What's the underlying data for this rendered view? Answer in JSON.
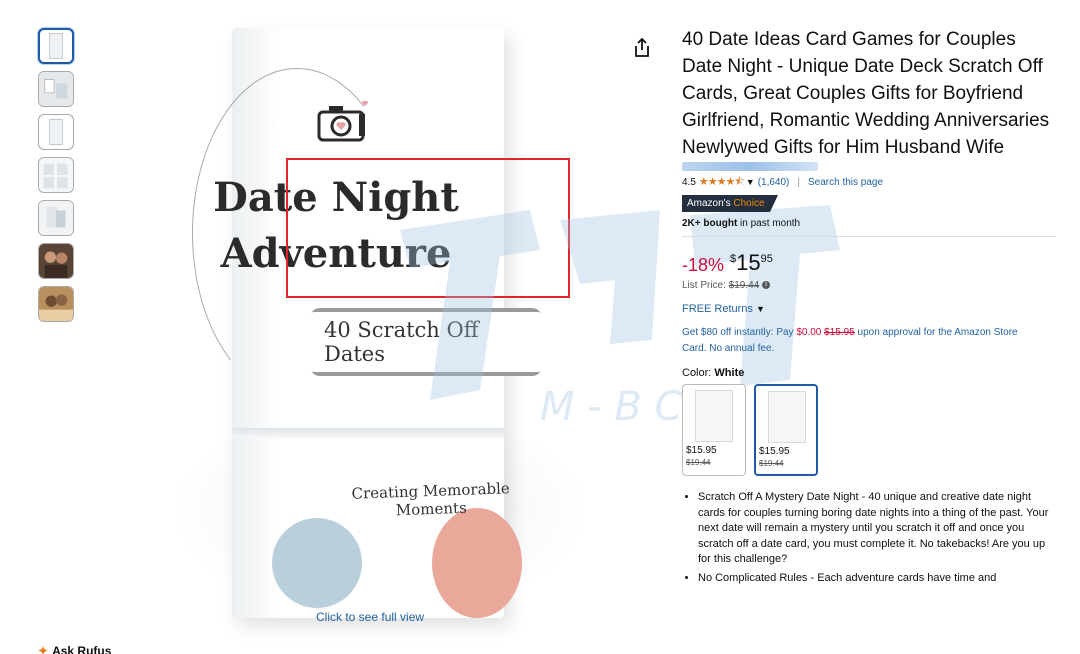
{
  "gallery": {
    "thumbnails": [
      "thumb-1",
      "thumb-2",
      "thumb-3",
      "thumb-4",
      "thumb-5",
      "thumb-6",
      "thumb-7"
    ],
    "click_full_view": "Click to see full view",
    "ask_rufus": "Ask Rufus"
  },
  "box": {
    "title_line1": "Date Night",
    "title_line2": "Adventure",
    "scratch_label": "40 Scratch Off Dates",
    "tagline": "Creating Memorable Moments"
  },
  "product": {
    "title": "40 Date Ideas Card Games for Couples Date Night - Unique Date Deck Scratch Off Cards, Great Couples Gifts for Boyfriend Girlfriend, Romantic Wedding Anniversaries Newlywed Gifts for Him Husband Wife",
    "rating_value": "4.5",
    "rating_stars": "★★★★⯪",
    "rating_count": "(1,640)",
    "search_page": "Search this page",
    "badge_prefix": "Amazon's",
    "badge_choice": "Choice",
    "bought_bold": "2K+ bought",
    "bought_rest": " in past month",
    "discount": "-18%",
    "price_symbol": "$",
    "price_whole": "15",
    "price_fraction": "95",
    "list_price_label": "List Price: ",
    "list_price_value": "$19.44",
    "free_returns": "FREE Returns",
    "promo_part1": "Get $80 off instantly: Pay ",
    "promo_zero": "$0.00",
    "promo_old": "$15.95",
    "promo_part2": " upon approval for the Amazon Store Card. No annual fee.",
    "color_label": "Color: ",
    "color_value": "White",
    "swatches": [
      {
        "price": "$15.95",
        "old": "$19.44"
      },
      {
        "price": "$15.95",
        "old": "$19.44"
      }
    ],
    "bullets": [
      "Scratch Off A Mystery Date Night - 40 unique and creative date night cards for couples turning boring date nights into a thing of the past. Your next date will remain a mystery until you scratch it off and once you scratch off a date card, you must complete it. No takebacks! Are you up for this challenge?",
      "No Complicated Rules - Each adventure cards have time and"
    ]
  },
  "colors": {
    "link": "#2162A1",
    "deal": "#CC0C39",
    "star": "#de7921",
    "badge_bg": "#232f3e",
    "badge_accent": "#f08804",
    "highlight_frame": "#e0262b"
  }
}
